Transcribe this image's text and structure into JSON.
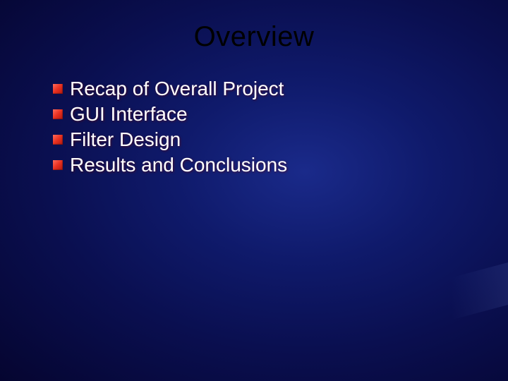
{
  "title": "Overview",
  "bullets": [
    {
      "text": "Recap of Overall Project"
    },
    {
      "text": "GUI Interface"
    },
    {
      "text": "Filter Design"
    },
    {
      "text": "Results and Conclusions"
    }
  ]
}
